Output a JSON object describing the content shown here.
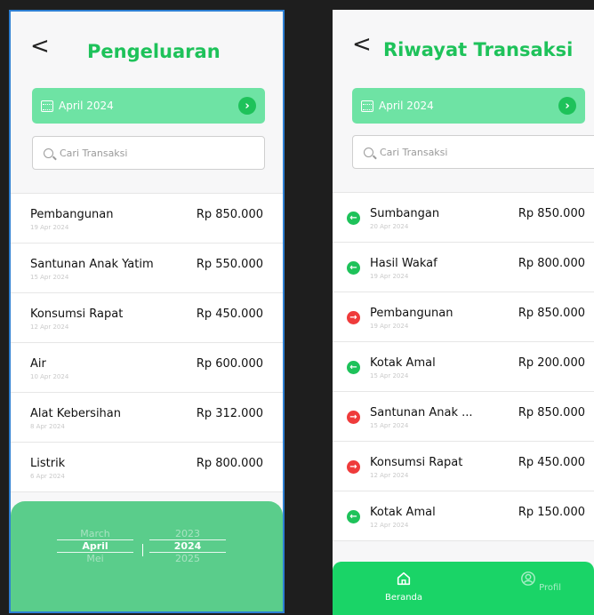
{
  "left": {
    "back": "<",
    "title": "Pengeluaran",
    "month_label": "April 2024",
    "search_placeholder": "Cari Transaksi",
    "items": [
      {
        "name": "Pembangunan",
        "date": "19 Apr 2024",
        "amount": "Rp 850.000"
      },
      {
        "name": "Santunan Anak Yatim",
        "date": "15 Apr 2024",
        "amount": "Rp 550.000"
      },
      {
        "name": "Konsumsi Rapat",
        "date": "12 Apr 2024",
        "amount": "Rp 450.000"
      },
      {
        "name": "Air",
        "date": "10 Apr 2024",
        "amount": "Rp 600.000"
      },
      {
        "name": "Alat Kebersihan",
        "date": "8 Apr 2024",
        "amount": "Rp 312.000"
      },
      {
        "name": "Listrik",
        "date": "6 Apr 2024",
        "amount": "Rp 800.000"
      }
    ],
    "picker": {
      "months": [
        "March",
        "April",
        "Mei"
      ],
      "years": [
        "2023",
        "2024",
        "2025"
      ],
      "selected_month": "April",
      "selected_year": "2024"
    }
  },
  "right": {
    "back": "<",
    "title": "Riwayat Transaksi",
    "month_label": "April 2024",
    "search_placeholder": "Cari Transaksi",
    "items": [
      {
        "name": "Sumbangan",
        "date": "20 Apr 2024",
        "amount": "Rp 850.000",
        "type": "in"
      },
      {
        "name": "Hasil Wakaf",
        "date": "19 Apr 2024",
        "amount": "Rp 800.000",
        "type": "in"
      },
      {
        "name": "Pembangunan",
        "date": "19 Apr 2024",
        "amount": "Rp 850.000",
        "type": "out"
      },
      {
        "name": "Kotak Amal",
        "date": "15 Apr 2024",
        "amount": "Rp 200.000",
        "type": "in"
      },
      {
        "name": "Santunan Anak ...",
        "date": "15 Apr 2024",
        "amount": "Rp 850.000",
        "type": "out"
      },
      {
        "name": "Konsumsi Rapat",
        "date": "12 Apr 2024",
        "amount": "Rp 450.000",
        "type": "out"
      },
      {
        "name": "Kotak Amal",
        "date": "12 Apr 2024",
        "amount": "Rp 150.000",
        "type": "in"
      }
    ],
    "nav": [
      {
        "label": "Beranda",
        "icon": "home-icon",
        "active": true
      },
      {
        "label": "Profil",
        "icon": "user-icon",
        "active": false
      }
    ]
  },
  "colors": {
    "accent": "#1ec25a",
    "month_bar": "#6ee3a4",
    "picker_bg": "#5acd8b",
    "nav_bg": "#1ad467",
    "income": "#1ec25a",
    "expense": "#ef3b3b"
  }
}
